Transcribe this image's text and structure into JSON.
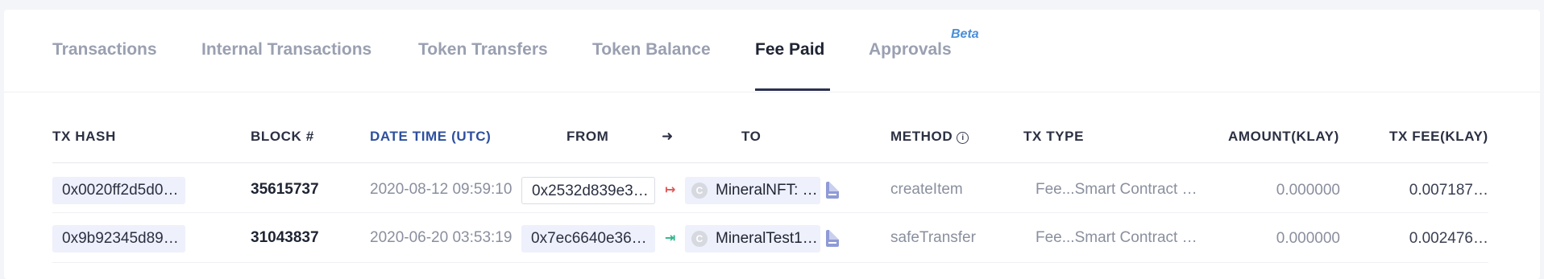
{
  "tabs": [
    {
      "label": "Transactions",
      "active": false
    },
    {
      "label": "Internal Transactions",
      "active": false
    },
    {
      "label": "Token Transfers",
      "active": false
    },
    {
      "label": "Token Balance",
      "active": false
    },
    {
      "label": "Fee Paid",
      "active": true
    },
    {
      "label": "Approvals",
      "active": false,
      "badge": "Beta"
    }
  ],
  "table": {
    "headers": {
      "tx_hash": "TX HASH",
      "block": "BLOCK #",
      "date_time": "DATE TIME (UTC)",
      "from": "FROM",
      "arrow": "➜",
      "to": "TO",
      "method": "METHOD",
      "tx_type": "TX TYPE",
      "amount": "AMOUNT(KLAY)",
      "tx_fee": "TX FEE(KLAY)"
    },
    "rows": [
      {
        "tx_hash": "0x0020ff2d5d0…",
        "block": "35615737",
        "date_time": "2020-08-12 09:59:10",
        "from": "0x2532d839e3…",
        "direction": "out",
        "direction_icon": "↦",
        "to_badge": "C",
        "to": "MineralNFT: …",
        "method": "createItem",
        "tx_type": "Fee...Smart Contract …",
        "amount": "0.000000",
        "tx_fee": "0.007187…"
      },
      {
        "tx_hash": "0x9b92345d89…",
        "block": "31043837",
        "date_time": "2020-06-20 03:53:19",
        "from": "0x7ec6640e36…",
        "direction": "in",
        "direction_icon": "⇥",
        "to_badge": "C",
        "to": "MineralTest1…",
        "method": "safeTransfer",
        "tx_type": "Fee...Smart Contract …",
        "amount": "0.000000",
        "tx_fee": "0.002476…"
      }
    ]
  },
  "colors": {
    "active_tab": "#1f2433",
    "inactive_tab": "#9aa0b1",
    "beta": "#4a8fd8",
    "date_header_link": "#2d4f9e",
    "direction_out": "#e05757",
    "direction_in": "#2fb38a",
    "doc_icon": "#8f9bd6"
  }
}
